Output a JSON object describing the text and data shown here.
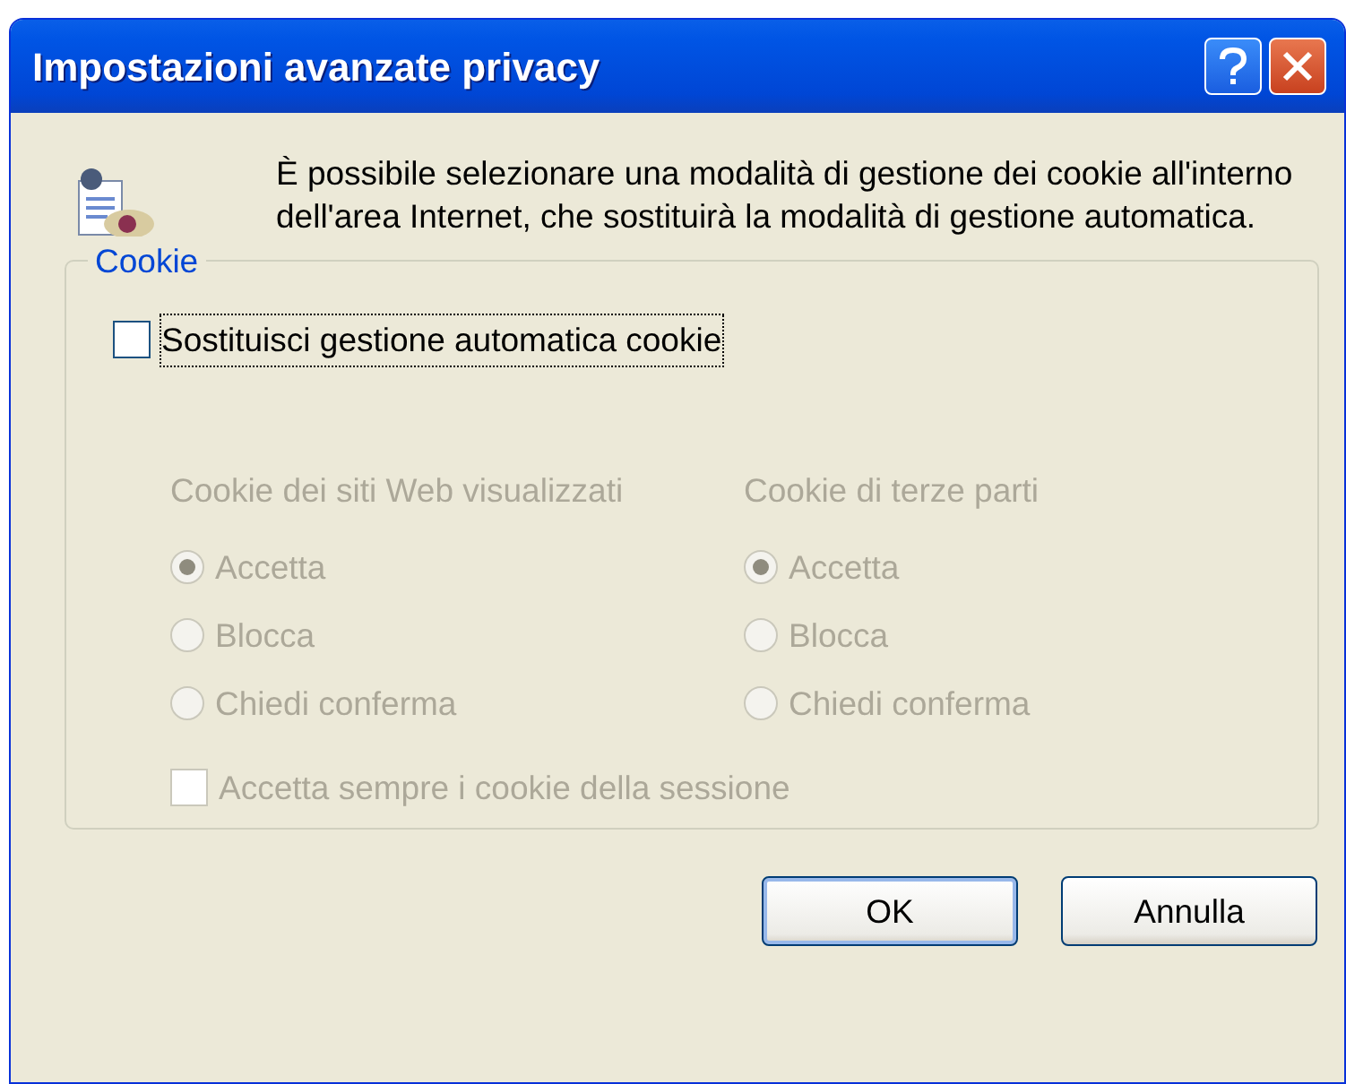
{
  "window": {
    "title": "Impostazioni avanzate privacy"
  },
  "description": "È possibile selezionare una modalità di gestione dei cookie all'interno dell'area Internet, che sostituirà la modalità di gestione automatica.",
  "cookie_group": {
    "legend": "Cookie",
    "override": {
      "label": "Sostituisci gestione automatica cookie",
      "checked": false
    },
    "columns": [
      {
        "heading": "Cookie dei siti Web visualizzati",
        "disabled": true,
        "options": [
          {
            "label": "Accetta",
            "selected": true
          },
          {
            "label": "Blocca",
            "selected": false
          },
          {
            "label": "Chiedi conferma",
            "selected": false
          }
        ]
      },
      {
        "heading": "Cookie di terze parti",
        "disabled": true,
        "options": [
          {
            "label": "Accetta",
            "selected": true
          },
          {
            "label": "Blocca",
            "selected": false
          },
          {
            "label": "Chiedi conferma",
            "selected": false
          }
        ]
      }
    ],
    "session": {
      "label": "Accetta sempre i cookie della sessione",
      "checked": false,
      "disabled": true
    }
  },
  "buttons": [
    {
      "label": "OK",
      "default": true
    },
    {
      "label": "Annulla",
      "default": false
    }
  ]
}
